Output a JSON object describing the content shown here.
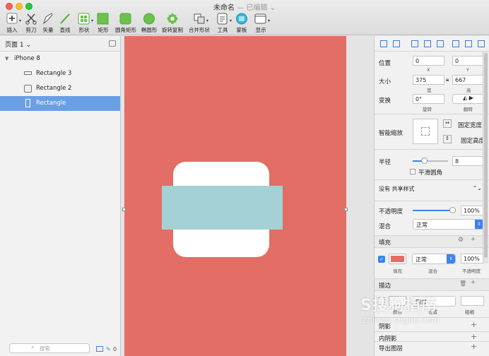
{
  "window": {
    "title": "未命名",
    "status": "— 已编辑 ⌄"
  },
  "toolbar": {
    "insert": "插入",
    "scissors": "剪刀",
    "vector": "矢量",
    "line": "直线",
    "shape": "形状",
    "rect": "矩形",
    "rounded_rect": "圆角矩形",
    "oval": "椭圆形",
    "rotate_copy": "旋转复制",
    "combine": "合并形状",
    "tools": "工具",
    "mask": "蒙板",
    "view": "显示"
  },
  "layers": {
    "page": "页面 1 ⌄",
    "artboard": "iPhone 8",
    "items": [
      {
        "label": "Rectangle 3"
      },
      {
        "label": "Rectangle 2"
      },
      {
        "label": "Rectangle"
      }
    ],
    "search_placeholder": "搜索",
    "layer_count": "0"
  },
  "inspector": {
    "position_label": "位置",
    "x_value": "0",
    "y_value": "0",
    "x_label": "X",
    "y_label": "Y",
    "size_label": "大小",
    "w_value": "375",
    "h_value": "667",
    "w_label": "宽",
    "h_label": "高",
    "transform_label": "变换",
    "rotate_value": "0°",
    "rotate_label": "旋转",
    "flip_label": "翻转",
    "resizing_label": "智能缩放",
    "fix_width": "固定宽度",
    "fix_height": "固定高度",
    "radius_label": "半径",
    "radius_value": "8",
    "smooth_corners": "平滑圆角",
    "shared_style": "没有 共享样式",
    "opacity_label": "不透明度",
    "opacity_value": "100%",
    "blend_label": "混合",
    "blend_value": "正常",
    "fill_label": "填充",
    "fill_blend": "正常",
    "fill_opacity": "100%",
    "fill_sub": "填充",
    "fill_blend_sub": "混合",
    "fill_opacity_sub": "不透明度",
    "border_label": "描边",
    "border_pos": "内部",
    "border_sub_color": "颜色",
    "border_sub_pos": "位置",
    "border_sub_thickness": "粗细",
    "shadow_label": "阴影",
    "inner_shadow_label": "内阴影",
    "export_label": "导出图层"
  },
  "colors": {
    "artboard_fill": "#e26e65",
    "rect_white": "#ffffff",
    "rect_teal": "#a4d1d5",
    "selection": "#6a9fe6",
    "accent": "#3a83f0"
  },
  "watermark": {
    "brand": "S搜狗指南",
    "url": "zhinan.sogou.com"
  }
}
